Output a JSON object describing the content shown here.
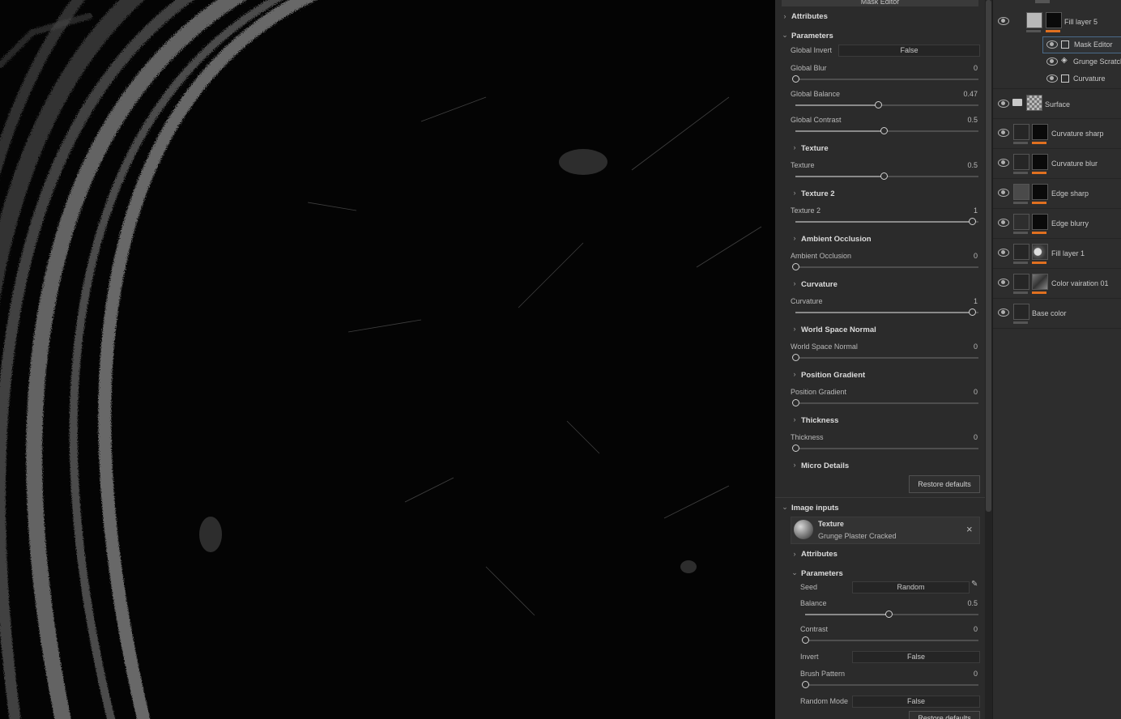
{
  "props": {
    "top_button": "Mask Editor",
    "attributes": "Attributes",
    "parameters": "Parameters",
    "global_invert": {
      "label": "Global Invert",
      "value": "False"
    },
    "sliders": [
      {
        "label": "Global Blur",
        "value": "0",
        "level": 0
      },
      {
        "label": "Global Balance",
        "value": "0.47",
        "level": 0.47
      },
      {
        "label": "Global Contrast",
        "value": "0.5",
        "level": 0.5
      }
    ],
    "sections": [
      {
        "header": "Texture",
        "label": "Texture",
        "value": "0.5",
        "level": 0.5
      },
      {
        "header": "Texture 2",
        "label": "Texture 2",
        "value": "1",
        "level": 1
      },
      {
        "header": "Ambient Occlusion",
        "label": "Ambient Occlusion",
        "value": "0",
        "level": 0
      },
      {
        "header": "Curvature",
        "label": "Curvature",
        "value": "1",
        "level": 1
      },
      {
        "header": "World Space Normal",
        "label": "World Space Normal",
        "value": "0",
        "level": 0
      },
      {
        "header": "Position Gradient",
        "label": "Position Gradient",
        "value": "0",
        "level": 0
      },
      {
        "header": "Thickness",
        "label": "Thickness",
        "value": "0",
        "level": 0
      }
    ],
    "micro_details": "Micro Details",
    "restore_defaults": "Restore defaults",
    "image_inputs": "Image inputs",
    "texture_card": {
      "title": "Texture",
      "subtitle": "Grunge Plaster Cracked"
    },
    "sub_attributes": "Attributes",
    "sub_parameters": "Parameters",
    "seed": {
      "label": "Seed",
      "value": "Random"
    },
    "balance": {
      "label": "Balance",
      "value": "0.5",
      "level": 0.5
    },
    "contrast": {
      "label": "Contrast",
      "value": "0",
      "level": 0
    },
    "invert": {
      "label": "Invert",
      "value": "False"
    },
    "brush_pattern": {
      "label": "Brush Pattern",
      "value": "0",
      "level": 0
    },
    "random_mode": {
      "label": "Random Mode",
      "value": "False"
    },
    "restore_defaults_2": "Restore defaults"
  },
  "layers": {
    "fill_layer_5": "Fill layer 5",
    "sub_items": [
      "Mask Editor",
      "Grunge Scratch",
      "Curvature"
    ],
    "surface": "Surface",
    "rows": [
      "Curvature sharp",
      "Curvature blur",
      "Edge sharp",
      "Edge blurry",
      "Fill layer 1",
      "Color vairation 01",
      "Base color"
    ]
  },
  "colors": {
    "accent_orange": "#e07020",
    "panel_bg": "#2b2b2b",
    "viewport_bg": "#040404"
  }
}
